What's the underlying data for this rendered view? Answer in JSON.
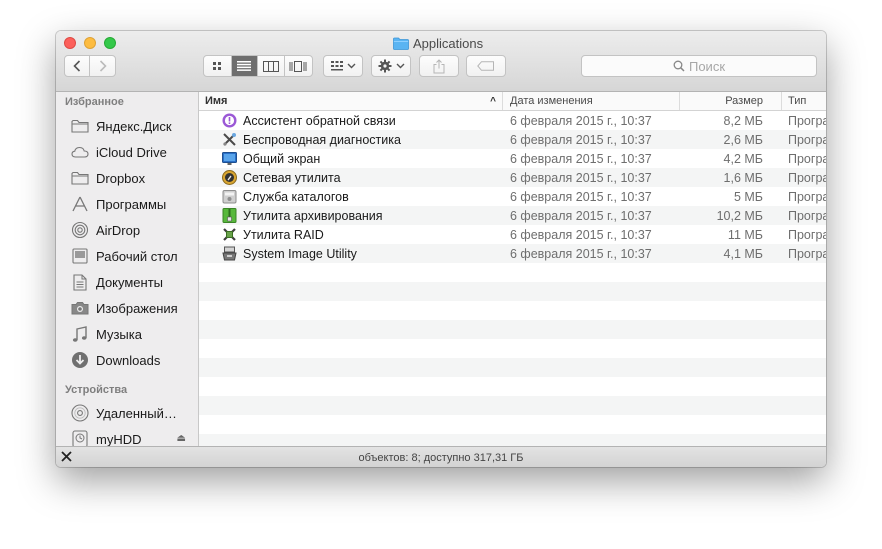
{
  "window": {
    "title": "Applications"
  },
  "toolbar": {
    "back_icon": "chevron-left-icon",
    "forward_icon": "chevron-right-icon",
    "view_modes": [
      "icon-view",
      "list-view",
      "column-view",
      "coverflow-view"
    ],
    "active_view": "list-view",
    "arrange_icon": "arrange-grid-icon",
    "action_icon": "gear-icon",
    "share_icon": "share-icon",
    "tags_icon": "tag-icon",
    "search_placeholder": "Поиск"
  },
  "sidebar": {
    "favorites_heading": "Избранное",
    "favorites": [
      {
        "label": "Яндекс.Диск",
        "icon": "folder-icon"
      },
      {
        "label": "iCloud Drive",
        "icon": "cloud-icon"
      },
      {
        "label": "Dropbox",
        "icon": "folder-icon"
      },
      {
        "label": "Программы",
        "icon": "applications-icon"
      },
      {
        "label": "AirDrop",
        "icon": "airdrop-icon"
      },
      {
        "label": "Рабочий стол",
        "icon": "desktop-icon"
      },
      {
        "label": "Документы",
        "icon": "documents-icon"
      },
      {
        "label": "Изображения",
        "icon": "camera-icon"
      },
      {
        "label": "Музыка",
        "icon": "music-icon"
      },
      {
        "label": "Downloads",
        "icon": "download-icon"
      }
    ],
    "devices_heading": "Устройства",
    "devices": [
      {
        "label": "Удаленный…",
        "icon": "disc-icon"
      },
      {
        "label": "myHDD",
        "icon": "time-machine-icon",
        "eject": "⏏"
      }
    ]
  },
  "list": {
    "columns": {
      "name": "Имя",
      "date": "Дата изменения",
      "size": "Размер",
      "type": "Тип"
    },
    "sort_indicator": "^",
    "rows": [
      {
        "name": "Ассистент обратной связи",
        "date": "6 февраля 2015 г., 10:37",
        "size": "8,2 МБ",
        "type": "Програ",
        "icon": "feedback-assistant-icon"
      },
      {
        "name": "Беспроводная диагностика",
        "date": "6 февраля 2015 г., 10:37",
        "size": "2,6 МБ",
        "type": "Програ",
        "icon": "wireless-diagnostics-icon"
      },
      {
        "name": "Общий экран",
        "date": "6 февраля 2015 г., 10:37",
        "size": "4,2 МБ",
        "type": "Програ",
        "icon": "screen-sharing-icon"
      },
      {
        "name": "Сетевая утилита",
        "date": "6 февраля 2015 г., 10:37",
        "size": "1,6 МБ",
        "type": "Програ",
        "icon": "network-utility-icon"
      },
      {
        "name": "Служба каталогов",
        "date": "6 февраля 2015 г., 10:37",
        "size": "5 МБ",
        "type": "Програ",
        "icon": "directory-utility-icon"
      },
      {
        "name": "Утилита архивирования",
        "date": "6 февраля 2015 г., 10:37",
        "size": "10,2 МБ",
        "type": "Програ",
        "icon": "archive-utility-icon"
      },
      {
        "name": "Утилита RAID",
        "date": "6 февраля 2015 г., 10:37",
        "size": "11 МБ",
        "type": "Програ",
        "icon": "raid-utility-icon"
      },
      {
        "name": "System Image Utility",
        "date": "6 февраля 2015 г., 10:37",
        "size": "4,1 МБ",
        "type": "Програ",
        "icon": "system-image-utility-icon"
      }
    ]
  },
  "status": {
    "text": "объектов: 8; доступно 317,31 ГБ",
    "icon": "hide-toolbar-icon"
  },
  "colors": {
    "folder_blue": "#5ab4f2",
    "row_alt": "#f4f5f5",
    "sidebar_bg": "#eeedee"
  }
}
